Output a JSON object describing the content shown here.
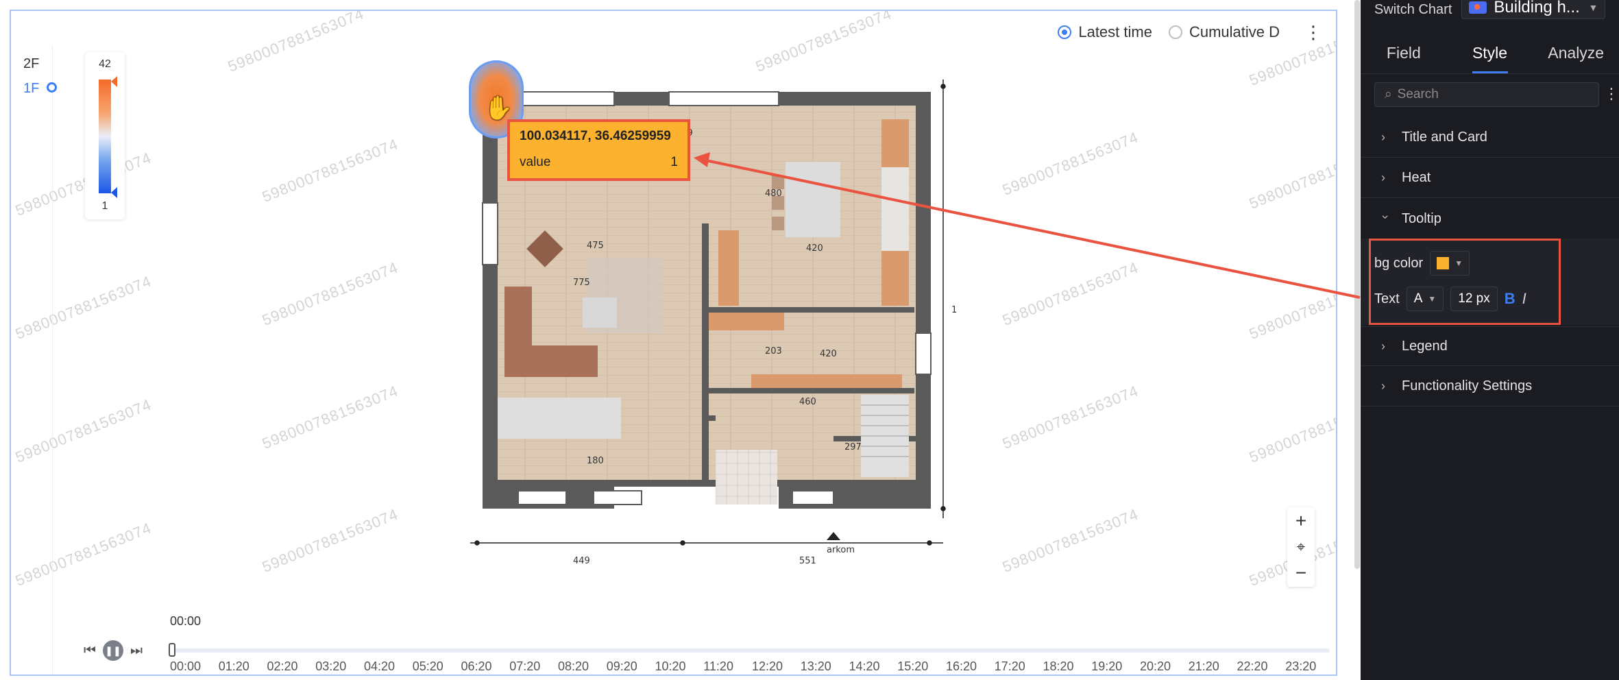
{
  "watermark": "5980007881563074",
  "floors": [
    "2F",
    "1F"
  ],
  "legend": {
    "max": "42",
    "min": "1"
  },
  "top_options": {
    "latest_time": "Latest time",
    "cumulative": "Cumulative D"
  },
  "plan_dims": {
    "d909": "909",
    "d475": "475",
    "d480": "480",
    "d420a": "420",
    "d775": "775",
    "d203": "203",
    "d420b": "420",
    "d460": "460",
    "d297": "297",
    "d180": "180",
    "d1100": "1100",
    "d449": "449",
    "d551": "551",
    "brand": "arkom"
  },
  "tooltip": {
    "coords": "100.034117, 36.46259959",
    "value_label": "value",
    "value": "1"
  },
  "map_tools": {
    "zoom_in": "+",
    "locate": "⌖",
    "zoom_out": "−"
  },
  "timeline": {
    "current": "00:00",
    "ticks": [
      "00:00",
      "01:20",
      "02:20",
      "03:20",
      "04:20",
      "05:20",
      "06:20",
      "07:20",
      "08:20",
      "09:20",
      "10:20",
      "11:20",
      "12:20",
      "13:20",
      "14:20",
      "15:20",
      "16:20",
      "17:20",
      "18:20",
      "19:20",
      "20:20",
      "21:20",
      "22:20",
      "23:20"
    ]
  },
  "panel": {
    "switch_chart": "Switch Chart",
    "chart_name": "Building h...",
    "tabs": [
      "Field",
      "Style",
      "Analyze"
    ],
    "search_placeholder": "Search",
    "sections": {
      "title_card": "Title and Card",
      "heat": "Heat",
      "tooltip": "Tooltip",
      "legend": "Legend",
      "functionality": "Functionality Settings"
    },
    "tooltip_props": {
      "bg_color_label": "bg color",
      "bg_color": "#fdb22f",
      "text_label": "Text",
      "font_option": "A",
      "font_size": "12 px",
      "bold": "B",
      "italic": "I"
    }
  },
  "colors": {
    "accent": "#3d7df5",
    "annotation": "#e9533f",
    "heat_high": "#f46b2a",
    "heat_low": "#1b57e6"
  }
}
